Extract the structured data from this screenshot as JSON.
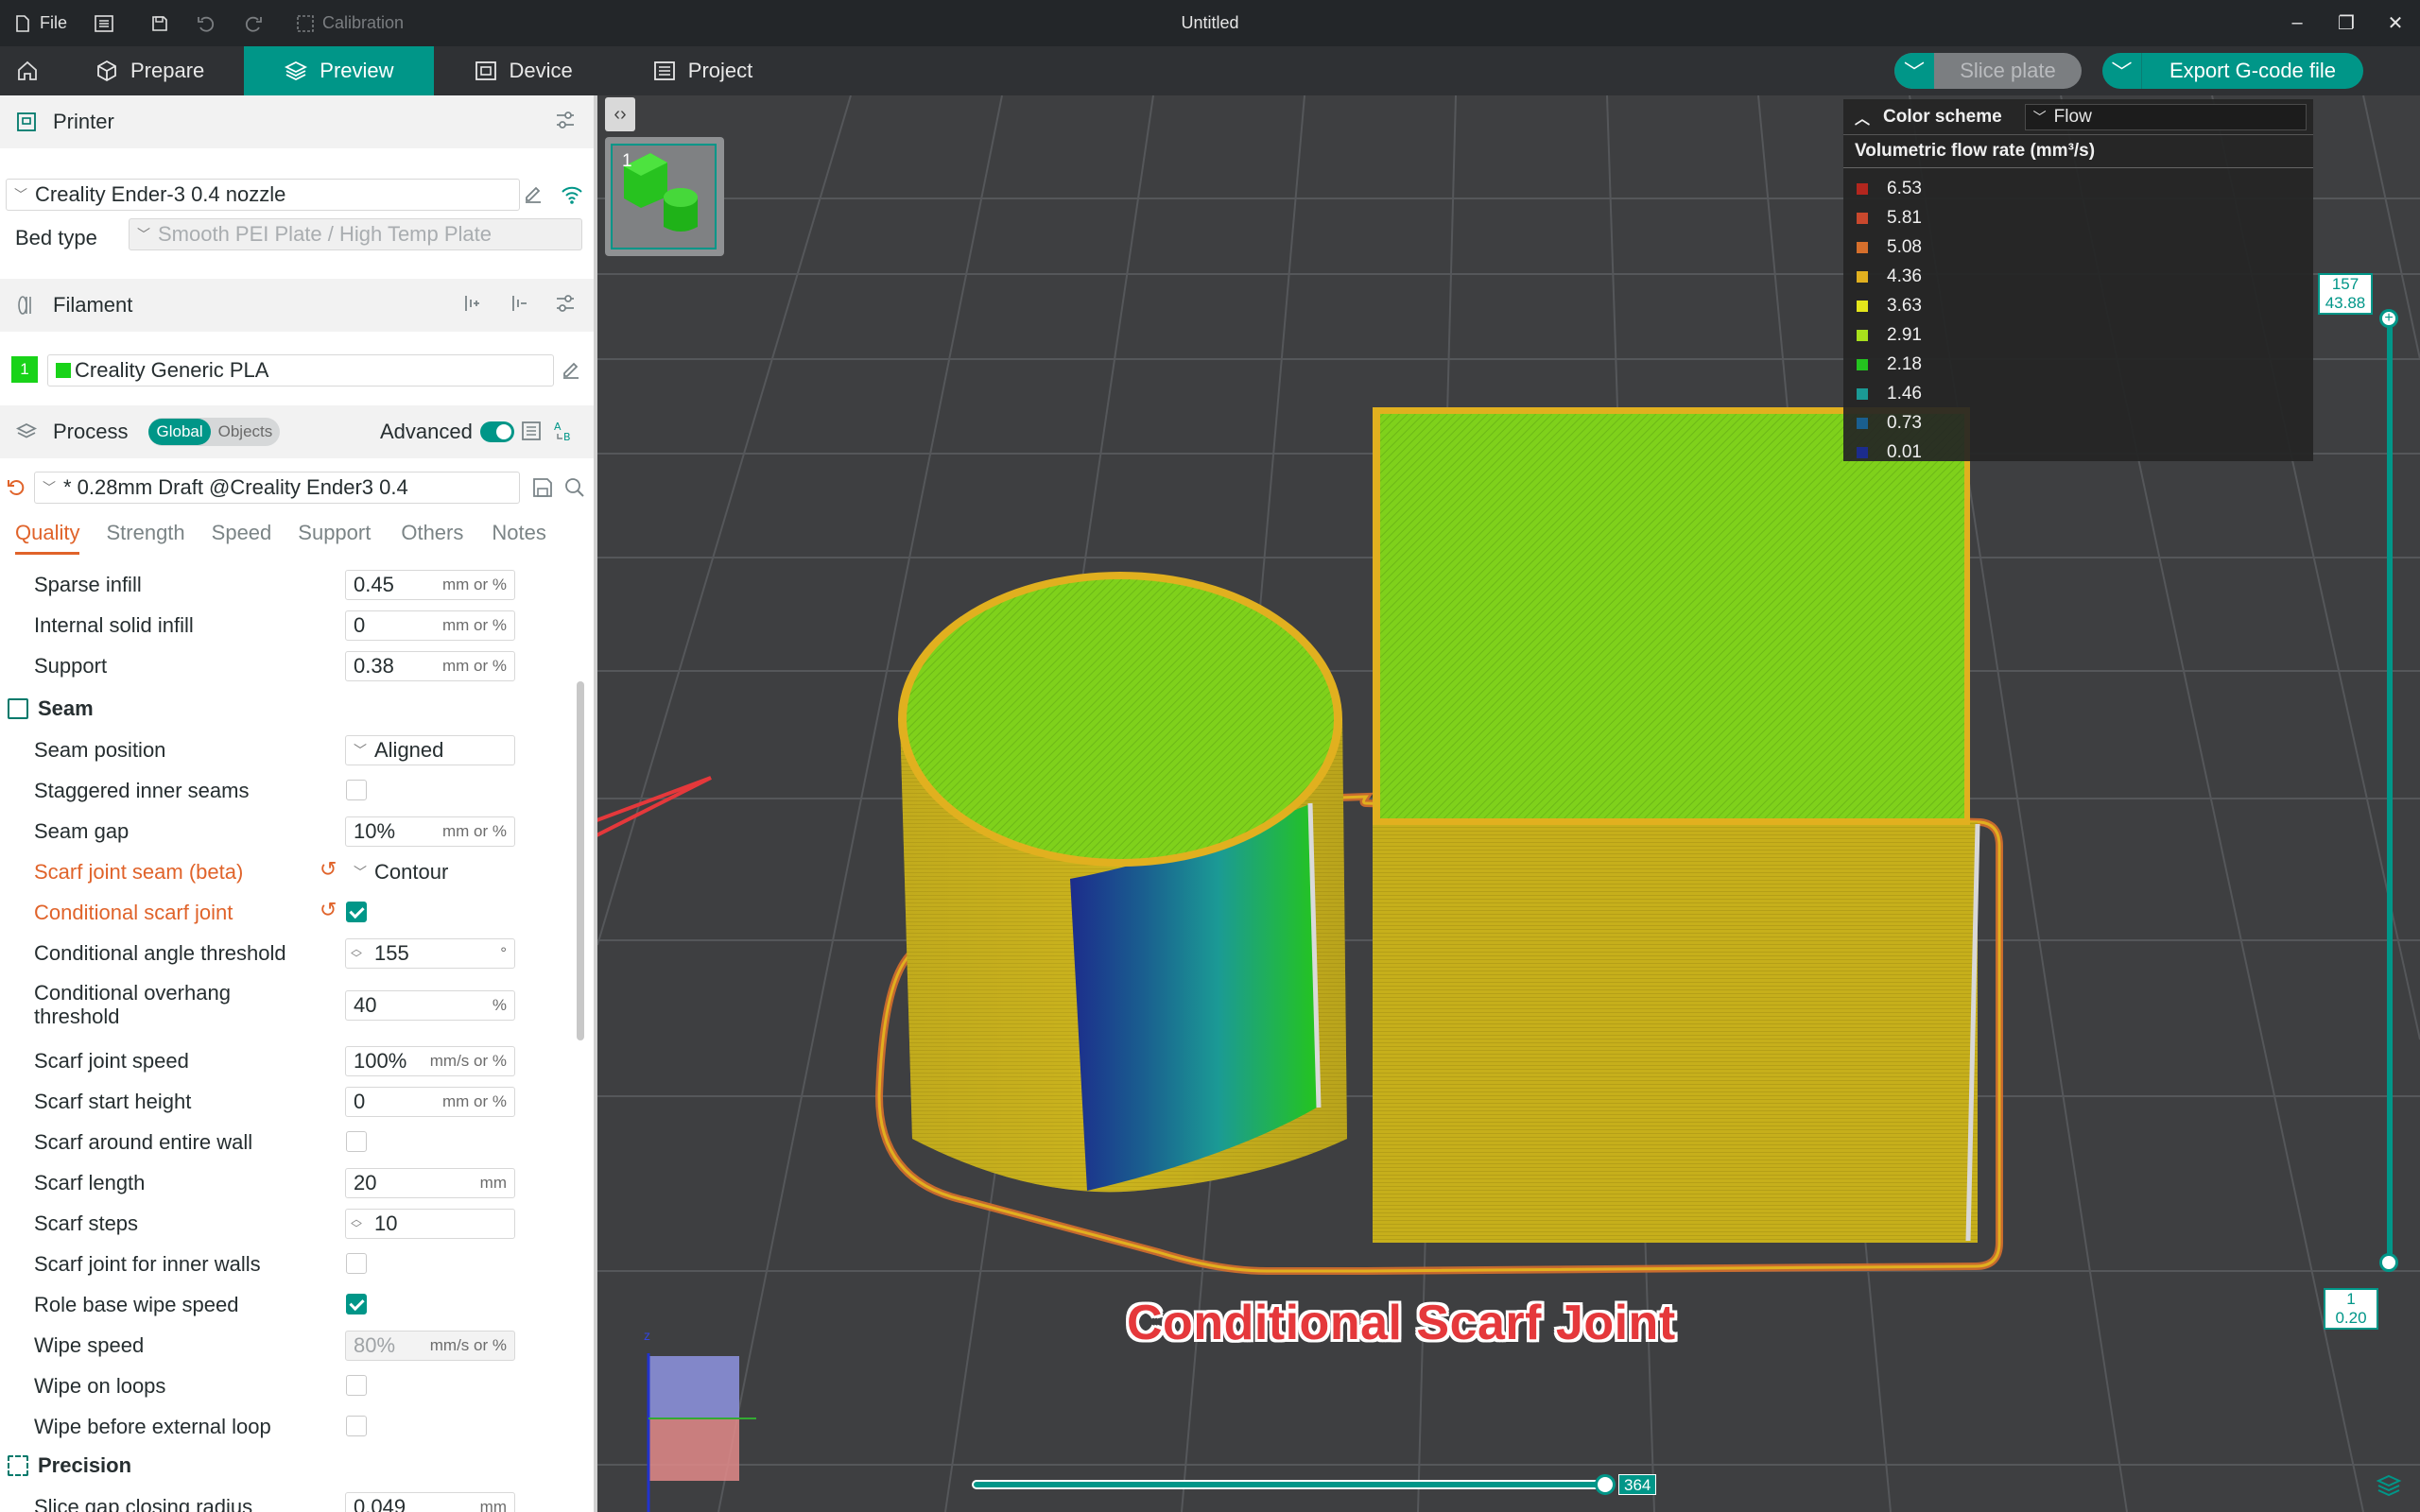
{
  "titlebar": {
    "file_label": "File",
    "calibration_label": "Calibration",
    "window_title": "Untitled"
  },
  "nav": {
    "tabs": [
      {
        "label": "Prepare",
        "active": false
      },
      {
        "label": "Preview",
        "active": true
      },
      {
        "label": "Device",
        "active": false
      },
      {
        "label": "Project",
        "active": false
      }
    ],
    "slice_plate_label": "Slice plate",
    "export_label": "Export G-code file"
  },
  "printer": {
    "header": "Printer",
    "selected": "Creality Ender-3 0.4 nozzle",
    "bed_type_label": "Bed type",
    "bed_type_value": "Smooth PEI Plate / High Temp Plate"
  },
  "filament": {
    "header": "Filament",
    "slot": "1",
    "name": "Creality Generic PLA",
    "color": "#19d319"
  },
  "process": {
    "header": "Process",
    "toggle_global": "Global",
    "toggle_objects": "Objects",
    "advanced_label": "Advanced",
    "preset": "* 0.28mm Draft @Creality Ender3 0.4",
    "tabs": [
      "Quality",
      "Strength",
      "Speed",
      "Support",
      "Others",
      "Notes"
    ],
    "active_tab": "Quality"
  },
  "settings": {
    "sparse_infill": {
      "label": "Sparse infill",
      "value": "0.45",
      "unit": "mm or %"
    },
    "internal_solid_infill": {
      "label": "Internal solid infill",
      "value": "0",
      "unit": "mm or %"
    },
    "support": {
      "label": "Support",
      "value": "0.38",
      "unit": "mm or %"
    },
    "seam_group": "Seam",
    "seam_position": {
      "label": "Seam position",
      "value": "Aligned"
    },
    "staggered_inner_seams": {
      "label": "Staggered inner seams",
      "checked": false
    },
    "seam_gap": {
      "label": "Seam gap",
      "value": "10%",
      "unit": "mm or %"
    },
    "scarf_joint_seam": {
      "label": "Scarf joint seam (beta)",
      "value": "Contour"
    },
    "conditional_scarf_joint": {
      "label": "Conditional scarf joint",
      "checked": true
    },
    "conditional_angle_threshold": {
      "label": "Conditional angle threshold",
      "value": "155",
      "unit": "°"
    },
    "conditional_overhang_threshold": {
      "label_line1": "Conditional overhang",
      "label_line2": "threshold",
      "value": "40",
      "unit": "%"
    },
    "scarf_joint_speed": {
      "label": "Scarf joint speed",
      "value": "100%",
      "unit": "mm/s or %"
    },
    "scarf_start_height": {
      "label": "Scarf start height",
      "value": "0",
      "unit": "mm or %"
    },
    "scarf_around_entire_wall": {
      "label": "Scarf around entire wall",
      "checked": false
    },
    "scarf_length": {
      "label": "Scarf length",
      "value": "20",
      "unit": "mm"
    },
    "scarf_steps": {
      "label": "Scarf steps",
      "value": "10"
    },
    "scarf_joint_inner_walls": {
      "label": "Scarf joint for inner walls",
      "checked": false
    },
    "role_base_wipe_speed": {
      "label": "Role base wipe speed",
      "checked": true
    },
    "wipe_speed": {
      "label": "Wipe speed",
      "value": "80%",
      "unit": "mm/s or %"
    },
    "wipe_on_loops": {
      "label": "Wipe on loops",
      "checked": false
    },
    "wipe_before_external_loop": {
      "label": "Wipe before external loop",
      "checked": false
    },
    "precision_group": "Precision",
    "slice_gap_closing_radius": {
      "label": "Slice gap closing radius",
      "value": "0.049",
      "unit": "mm"
    }
  },
  "legend": {
    "header": "Color scheme",
    "scheme": "Flow",
    "title": "Volumetric flow rate (mm³/s)",
    "items": [
      {
        "value": "6.53",
        "color": "#b3261e"
      },
      {
        "value": "5.81",
        "color": "#c9482d"
      },
      {
        "value": "5.08",
        "color": "#d66f2c"
      },
      {
        "value": "4.36",
        "color": "#e1b01f"
      },
      {
        "value": "3.63",
        "color": "#e4e61b"
      },
      {
        "value": "2.91",
        "color": "#a8e01c"
      },
      {
        "value": "2.18",
        "color": "#24c41f"
      },
      {
        "value": "1.46",
        "color": "#1b9a95"
      },
      {
        "value": "0.73",
        "color": "#1a5f8f"
      },
      {
        "value": "0.01",
        "color": "#1c2c8c"
      }
    ]
  },
  "plate_thumb_number": "1",
  "vslider": {
    "top_layer": "157",
    "top_height": "43.88",
    "bottom_layer": "1",
    "bottom_height": "0.20"
  },
  "hslider": {
    "value": "364"
  },
  "axis_label": "z",
  "caption": "Conditional Scarf Joint"
}
